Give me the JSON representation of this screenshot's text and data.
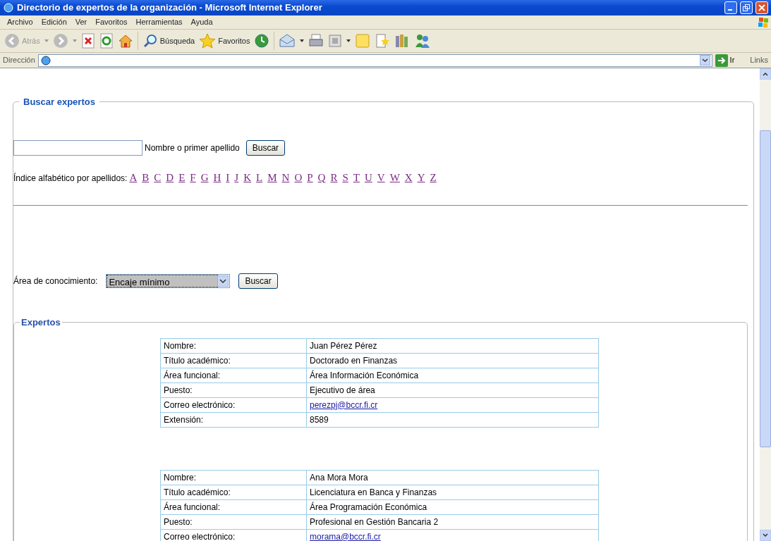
{
  "window": {
    "title": "Directorio de expertos de la organización - Microsoft Internet Explorer"
  },
  "menu": [
    "Archivo",
    "Edición",
    "Ver",
    "Favoritos",
    "Herramientas",
    "Ayuda"
  ],
  "toolbar": {
    "back": {
      "label": "Atrás",
      "disabled": true
    },
    "search_label": "Búsqueda",
    "favorites_label": "Favoritos"
  },
  "address_bar": {
    "label": "Dirección",
    "go": "Ir",
    "links": "Links"
  },
  "search": {
    "legend": "Buscar expertos",
    "name_hint": "Nombre o primer apellido",
    "button": "Buscar",
    "index_label": "Índice alfabético por apellidos:",
    "letters": [
      "A",
      "B",
      "C",
      "D",
      "E",
      "F",
      "G",
      "H",
      "I",
      "J",
      "K",
      "L",
      "M",
      "N",
      "O",
      "P",
      "Q",
      "R",
      "S",
      "T",
      "U",
      "V",
      "W",
      "X",
      "Y",
      "Z"
    ]
  },
  "area": {
    "label": "Área de conocimiento:",
    "value": "Encaje mínimo",
    "focused": true,
    "button": "Buscar"
  },
  "experts": {
    "legend": "Expertos",
    "cards": [
      {
        "rows": [
          {
            "label": "Nombre:",
            "value": "Juan Pérez Pérez",
            "kind": "text"
          },
          {
            "label": "Título académico:",
            "value": "Doctorado en Finanzas",
            "kind": "text"
          },
          {
            "label": "Área funcional:",
            "value": "Área Información Económica",
            "kind": "text"
          },
          {
            "label": "Puesto:",
            "value": "Ejecutivo de área",
            "kind": "text"
          },
          {
            "label": "Correo electrónico:",
            "value": "perezpj@bccr.fi.cr",
            "kind": "email"
          },
          {
            "label": "Extensión:",
            "value": "8589",
            "kind": "text"
          }
        ]
      },
      {
        "rows": [
          {
            "label": "Nombre:",
            "value": "Ana Mora Mora",
            "kind": "text"
          },
          {
            "label": "Título académico:",
            "value": "Licenciatura en Banca y Finanzas",
            "kind": "text"
          },
          {
            "label": "Área funcional:",
            "value": "Área Programación Económica",
            "kind": "text"
          },
          {
            "label": "Puesto:",
            "value": "Profesional en Gestión Bancaria 2",
            "kind": "text"
          },
          {
            "label": "Correo electrónico:",
            "value": "morama@bccr.fi.cr",
            "kind": "email"
          }
        ]
      }
    ]
  }
}
